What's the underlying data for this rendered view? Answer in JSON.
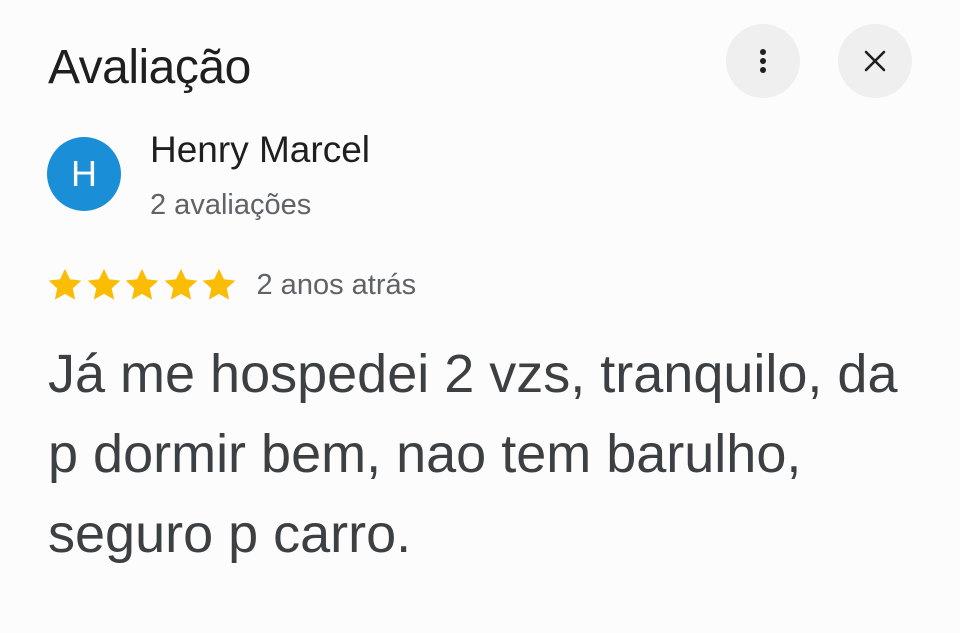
{
  "header": {
    "title": "Avaliação",
    "more_icon": "more-vertical-icon",
    "close_icon": "close-icon"
  },
  "reviewer": {
    "initial": "H",
    "avatar_color": "#1a8fd8",
    "name": "Henry Marcel",
    "review_count": "2 avaliações"
  },
  "rating": {
    "stars": 5,
    "max_stars": 5,
    "star_color": "#fbbc04",
    "date": "2 anos atrás"
  },
  "review": {
    "text": "Já me hospedei 2 vzs, tranquilo, da p dormir bem, nao tem barulho, seguro p carro."
  }
}
